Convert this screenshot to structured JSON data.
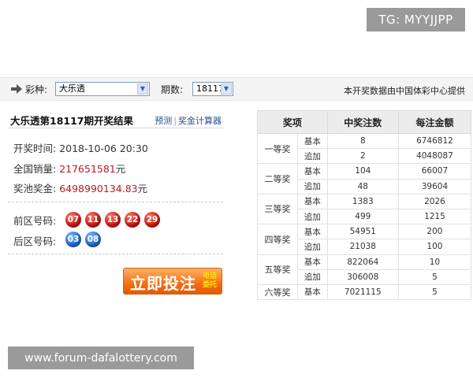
{
  "watermark_top": "TG: MYYJJPP",
  "watermark_bottom": "www.forum-dafalottery.com",
  "filter": {
    "lottery_label": "彩种:",
    "lottery_value": "大乐透",
    "period_label": "期数:",
    "period_value": "18117",
    "provider_note": "本开奖数据由中国体彩中心提供"
  },
  "result": {
    "title": "大乐透第18117期开奖结果",
    "link_forecast": "预测",
    "link_separator": "|",
    "link_calculator": "奖金计算器",
    "draw_time_label": "开奖时间:",
    "draw_time_value": "2018-10-06 20:30",
    "sales_label": "全国销量:",
    "sales_value": "217651581",
    "sales_unit": "元",
    "pool_label": "奖池奖金:",
    "pool_value": "6498990134.83",
    "pool_unit": "元",
    "front_label": "前区号码:",
    "front_balls": [
      "07",
      "11",
      "13",
      "22",
      "29"
    ],
    "back_label": "后区号码:",
    "back_balls": [
      "03",
      "08"
    ],
    "bet_button": "立即投注",
    "bet_side_1": "电话",
    "bet_side_2": "委托"
  },
  "prize_table": {
    "headers": [
      "奖项",
      "中奖注数",
      "每注金额"
    ],
    "rows": [
      {
        "level": "一等奖",
        "type": "基本",
        "count": "8",
        "amount": "6746812"
      },
      {
        "level": "",
        "type": "追加",
        "count": "2",
        "amount": "4048087"
      },
      {
        "level": "二等奖",
        "type": "基本",
        "count": "104",
        "amount": "66007"
      },
      {
        "level": "",
        "type": "追加",
        "count": "48",
        "amount": "39604"
      },
      {
        "level": "三等奖",
        "type": "基本",
        "count": "1383",
        "amount": "2026"
      },
      {
        "level": "",
        "type": "追加",
        "count": "499",
        "amount": "1215"
      },
      {
        "level": "四等奖",
        "type": "基本",
        "count": "54951",
        "amount": "200"
      },
      {
        "level": "",
        "type": "追加",
        "count": "21038",
        "amount": "100"
      },
      {
        "level": "五等奖",
        "type": "基本",
        "count": "822064",
        "amount": "10"
      },
      {
        "level": "",
        "type": "追加",
        "count": "306008",
        "amount": "5"
      },
      {
        "level": "六等奖",
        "type": "基本",
        "count": "7021115",
        "amount": "5"
      }
    ]
  },
  "colors": {
    "accent_red": "#c0161a",
    "ball_red": "#d01b14",
    "ball_blue": "#1f6fd6",
    "button_orange": "#f46e12"
  }
}
